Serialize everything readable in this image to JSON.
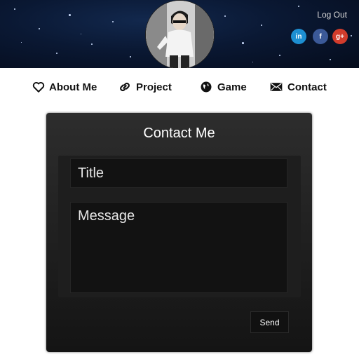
{
  "header": {
    "logout_label": "Log Out",
    "social": [
      {
        "name": "linkedin-icon",
        "glyph": "in",
        "color": "#1d8fd2"
      },
      {
        "name": "facebook-icon",
        "glyph": "f",
        "color": "#3b5998"
      },
      {
        "name": "google-plus-icon",
        "glyph": "g+",
        "color": "#d23c2c"
      }
    ]
  },
  "nav": {
    "items": [
      {
        "label": "About Me",
        "icon": "heart-icon"
      },
      {
        "label": "Project",
        "icon": "link-icon"
      },
      {
        "label": "Game",
        "icon": "globe-icon"
      },
      {
        "label": "Contact",
        "icon": "envelope-icon"
      }
    ]
  },
  "contact_form": {
    "title": "Contact Me",
    "title_placeholder": "Title",
    "message_placeholder": "Message",
    "send_label": "Send"
  }
}
